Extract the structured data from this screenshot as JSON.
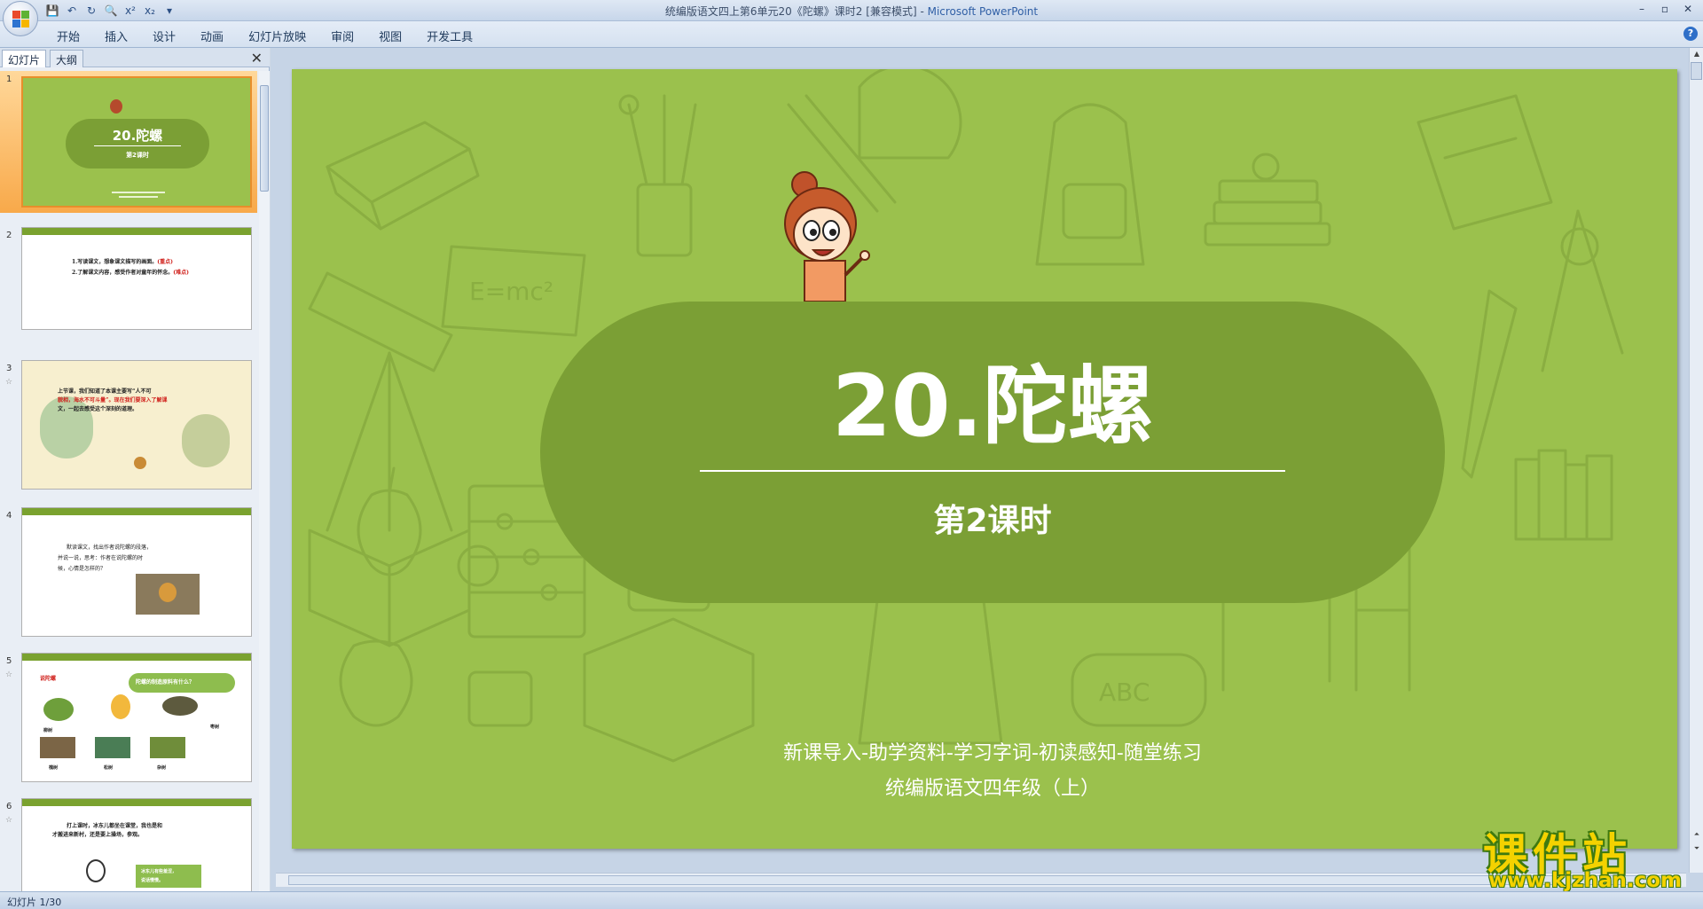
{
  "window": {
    "title": "统编版语文四上第6单元20《陀螺》课时2 [兼容模式]",
    "title_sep": " - ",
    "app_name": "Microsoft PowerPoint",
    "controls": {
      "minimize": "–",
      "restore": "▫",
      "close": "✕"
    }
  },
  "quick_access": [
    {
      "name": "save",
      "glyph": "💾"
    },
    {
      "name": "undo",
      "glyph": "↶"
    },
    {
      "name": "redo",
      "glyph": "↻"
    },
    {
      "name": "print-preview",
      "glyph": "🔍"
    },
    {
      "name": "superscript",
      "glyph": "x²"
    },
    {
      "name": "subscript",
      "glyph": "x₂"
    },
    {
      "name": "customize",
      "glyph": "▾"
    }
  ],
  "ribbon": {
    "tabs": [
      "开始",
      "插入",
      "设计",
      "动画",
      "幻灯片放映",
      "审阅",
      "视图",
      "开发工具"
    ],
    "help": "?"
  },
  "left_panel": {
    "tabs": [
      "幻灯片",
      "大纲"
    ],
    "close": "✕",
    "slides": [
      {
        "num": "1",
        "title": "20.陀螺",
        "subtitle": "第2课时",
        "selected": true
      },
      {
        "num": "2",
        "lines": [
          "1.写读课文，想象课文描写的画面。",
          "2.了解课文内容，感受作者对童年的怀念。"
        ],
        "tag": "(重点)",
        "tag2": "(难点)"
      },
      {
        "num": "3",
        "lines": [
          "上节课，我们知道了本课主要写“人不可",
          "貌相，海水不可斗量”。现在我们要深入了解课",
          "文，一起去感受这个深刻的道理。"
        ]
      },
      {
        "num": "4",
        "lines": [
          "默读课文，找出作者说陀螺的段落，",
          "并说一说，思考：作者在说陀螺的时",
          "候，心情是怎样的？"
        ]
      },
      {
        "num": "5",
        "lines": [
          "说陀螺",
          "陀螺的制造原料有什么？",
          "柳树",
          "槐树",
          "松树",
          "杂树",
          "枣树"
        ]
      },
      {
        "num": "6",
        "lines": [
          "打上课时，冰东儿都坐在课堂，我也是和",
          "才搬进来新村，还是要上操场，参观。",
          "冰东儿有些羞涩，",
          "说话慢慢。"
        ]
      }
    ]
  },
  "slide": {
    "title": "20.陀螺",
    "subtitle": "第2课时",
    "footer_line1": "新课导入-助学资料-学习字词-初读感知-随堂练习",
    "footer_line2": "统编版语文四年级（上）",
    "background_color": "#9bc14d",
    "pill_color": "#7b9f35"
  },
  "watermark": {
    "title": "课件站",
    "url": "www.kjzhan.com"
  },
  "status_bar": {
    "text": "幻灯片 1/30"
  }
}
